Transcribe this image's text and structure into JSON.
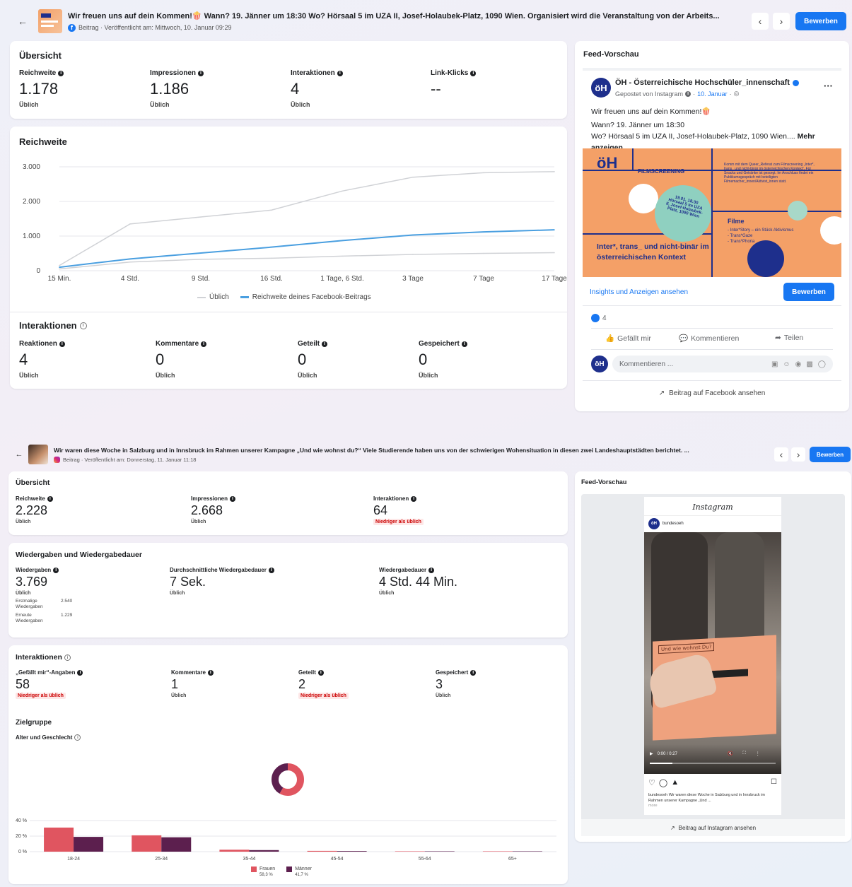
{
  "post1": {
    "title": "Wir freuen uns auf dein Kommen!🍿 Wann? 19. Jänner um 18:30 Wo? Hörsaal 5 im UZA II, Josef-Holaubek-Platz, 1090 Wien. Organisiert wird die Veranstaltung von der Arbeits...",
    "meta": "Beitrag · Veröffentlicht am: Mittwoch, 10. Januar 09:29",
    "promote": "Bewerben",
    "overview": {
      "title": "Übersicht",
      "metrics": [
        {
          "label": "Reichweite",
          "value": "1.178",
          "sub": "Üblich"
        },
        {
          "label": "Impressionen",
          "value": "1.186",
          "sub": "Üblich"
        },
        {
          "label": "Interaktionen",
          "value": "4",
          "sub": "Üblich"
        },
        {
          "label": "Link-Klicks",
          "value": "--",
          "sub": ""
        }
      ]
    },
    "reach": {
      "title": "Reichweite",
      "legend_typical": "Üblich",
      "legend_series": "Reichweite deines Facebook-Beitrags"
    },
    "interactions": {
      "title": "Interaktionen",
      "metrics": [
        {
          "label": "Reaktionen",
          "value": "4",
          "sub": "Üblich"
        },
        {
          "label": "Kommentare",
          "value": "0",
          "sub": "Üblich"
        },
        {
          "label": "Geteilt",
          "value": "0",
          "sub": "Üblich"
        },
        {
          "label": "Gespeichert",
          "value": "0",
          "sub": "Üblich"
        }
      ]
    },
    "preview": {
      "title": "Feed-Vorschau",
      "page_name": "ÖH - Österreichische Hochschüler_innenschaft",
      "posted_via": "Gepostet von Instagram",
      "date": "10. Januar",
      "text1": "Wir freuen uns auf dein Kommen!🍿",
      "text2": "Wann? 19. Jänner um 18:30",
      "text3": "Wo? Hörsaal 5 im UZA II, Josef-Holaubek-Platz, 1090 Wien....",
      "more": "Mehr anzeigen",
      "poster": {
        "logo": "öH",
        "heading": "FILMSCREENING",
        "bubble": "19.01, 18:30\nHörsaal 5 im UZA II, Josef-Holaubek-Platz, 1090 Wien",
        "films_title": "Filme",
        "films": "- Inter*Story – ein Stück Aktivismus\n- Trans*Gaze\n- Trans*Phoria",
        "tagline": "Inter*, trans_ und nicht-binär im österreichischen Kontext",
        "blurb": "Komm mit dem Queer_Referat zum Filmscreening „Inter*, trans_ und nicht-binär im österreichischen Kontext“. Für Snacks und Getränke ist gesorgt. Im Anschluss findet ein Publikumsgespräch mit beteiligten Filmemacher_innen/Aktivist_innen statt."
      },
      "insights_link": "Insights und Anzeigen ansehen",
      "promote": "Bewerben",
      "reactions": "4",
      "like": "Gefällt mir",
      "comment": "Kommentieren",
      "share": "Teilen",
      "comment_placeholder": "Kommentieren ...",
      "view_link": "Beitrag auf Facebook ansehen"
    }
  },
  "post2": {
    "title": "Wir waren diese Woche in Salzburg und in Innsbruck im Rahmen unserer Kampagne „Und wie wohnst du?“ Viele Studierende haben uns von der schwierigen Wohensituation in diesen zwei Landeshauptstädten berichtet. ...",
    "meta": "Beitrag · Veröffentlicht am: Donnerstag, 11. Januar 11:18",
    "promote": "Bewerben",
    "overview": {
      "title": "Übersicht",
      "metrics": [
        {
          "label": "Reichweite",
          "value": "2.228",
          "sub": "Üblich"
        },
        {
          "label": "Impressionen",
          "value": "2.668",
          "sub": "Üblich"
        },
        {
          "label": "Interaktionen",
          "value": "64",
          "sub": "Niedriger als üblich"
        }
      ]
    },
    "plays": {
      "title": "Wiedergaben und Wiedergabedauer",
      "metrics": [
        {
          "label": "Wiedergaben",
          "value": "3.769",
          "sub": "Üblich"
        },
        {
          "label": "Durchschnittliche Wiedergabedauer",
          "value": "7 Sek.",
          "sub": "Üblich"
        },
        {
          "label": "Wiedergabedauer",
          "value": "4 Std. 44 Min.",
          "sub": "Üblich"
        }
      ],
      "first_label": "Erstmalige Wiedergaben",
      "first_value": "2.540",
      "repeat_label": "Erneute Wiedergaben",
      "repeat_value": "1.229"
    },
    "interactions": {
      "title": "Interaktionen",
      "metrics": [
        {
          "label": "„Gefällt mir“-Angaben",
          "value": "58",
          "sub": "Niedriger als üblich"
        },
        {
          "label": "Kommentare",
          "value": "1",
          "sub": "Üblich"
        },
        {
          "label": "Geteilt",
          "value": "2",
          "sub": "Niedriger als üblich"
        },
        {
          "label": "Gespeichert",
          "value": "3",
          "sub": "Üblich"
        }
      ]
    },
    "audience": {
      "title": "Zielgruppe",
      "subtitle": "Alter und Geschlecht",
      "women": "Frauen",
      "women_pct": "58,3 %",
      "men": "Männer",
      "men_pct": "41,7 %"
    },
    "preview": {
      "title": "Feed-Vorschau",
      "ig_logo": "Instagram",
      "account": "bundesoeh",
      "video_time": "0:00 / 0:27",
      "box_text": "Und wie wohnst Du?",
      "caption": "bundesoeh Wir waren diese Woche in Salzburg und in Innsbruck im Rahmen unserer Kampagne „Und ...",
      "more": "more",
      "view_link": "Beitrag auf Instagram ansehen"
    }
  },
  "chart_data": [
    {
      "type": "line",
      "title": "Reichweite",
      "categories": [
        "15 Min.",
        "4 Std.",
        "9 Std.",
        "16 Std.",
        "1 Tage, 6 Std.",
        "3 Tage",
        "7 Tage",
        "17 Tage"
      ],
      "ylim": [
        0,
        3000
      ],
      "yticks": [
        "0",
        "1.000",
        "2.000",
        "3.000"
      ],
      "series": [
        {
          "name": "Reichweite deines Facebook-Beitrags",
          "color": "#4a9fe0",
          "values": [
            100,
            340,
            510,
            680,
            870,
            1030,
            1120,
            1180
          ]
        },
        {
          "name": "Üblich",
          "color": "#d0d2d6",
          "values": [
            150,
            1350,
            1550,
            1750,
            2300,
            2700,
            2830,
            2860
          ]
        },
        {
          "name": "Üblich",
          "color": "#d0d2d6",
          "values": [
            50,
            250,
            330,
            360,
            420,
            470,
            500,
            520
          ]
        }
      ]
    },
    {
      "type": "donut",
      "values": [
        58.3,
        41.7
      ],
      "labels": [
        "Frauen",
        "Männer"
      ],
      "colors": [
        "#e05560",
        "#5c1f4e"
      ]
    },
    {
      "type": "bar",
      "categories": [
        "18-24",
        "25-34",
        "35-44",
        "45-54",
        "55-64",
        "65+"
      ],
      "yticks": [
        "0 %",
        "20 %",
        "40 %"
      ],
      "ylim": [
        0,
        40
      ],
      "series": [
        {
          "name": "Frauen",
          "color": "#e05560",
          "values": [
            31,
            21,
            2.5,
            1,
            0.5,
            0.5
          ]
        },
        {
          "name": "Männer",
          "color": "#5c1f4e",
          "values": [
            19,
            18.5,
            2,
            0.8,
            0.5,
            0.5
          ]
        }
      ]
    }
  ]
}
